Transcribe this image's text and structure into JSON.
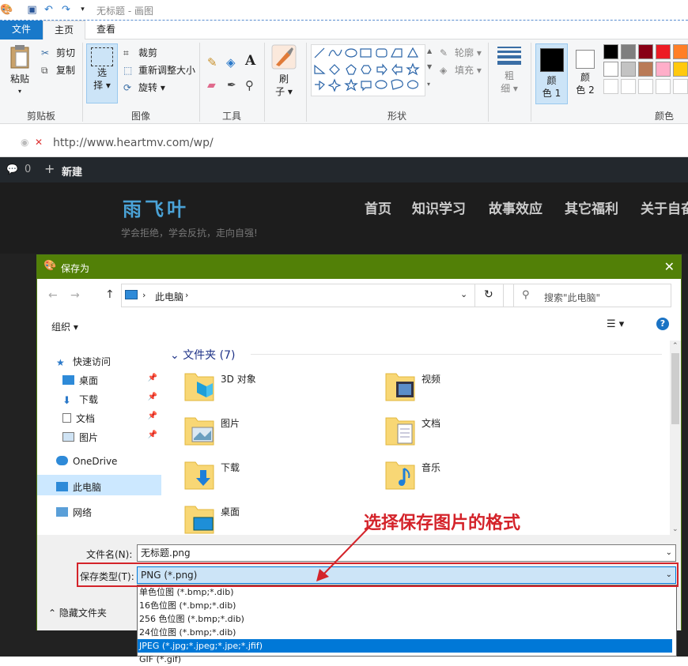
{
  "titlebar": {
    "title": "无标题 - 画图"
  },
  "tabs": {
    "file": "文件",
    "home": "主页",
    "view": "查看"
  },
  "ribbon": {
    "clipboard": {
      "paste": "粘贴",
      "cut": "剪切",
      "copy": "复制",
      "label": "剪贴板"
    },
    "image": {
      "select_top": "选",
      "select_bottom": "择",
      "crop": "裁剪",
      "resize": "重新调整大小",
      "rotate": "旋转",
      "label": "图像"
    },
    "tools": {
      "label": "工具"
    },
    "brush": {
      "top": "刷",
      "bottom": "子"
    },
    "shapes": {
      "outline": "轮廓",
      "fill": "填充",
      "label": "形状"
    },
    "size": {
      "top": "粗",
      "bottom": "细"
    },
    "color1": {
      "top": "颜",
      "bottom": "色 1"
    },
    "color2": {
      "top": "颜",
      "bottom": "色 2"
    },
    "colors": {
      "label": "颜色",
      "row1": [
        "#000000",
        "#7f7f7f",
        "#880015",
        "#ed1c24",
        "#ff7f27"
      ],
      "row2": [
        "#ffffff",
        "#c3c3c3",
        "#b97a57",
        "#ffaec9",
        "#ffc90e"
      ]
    }
  },
  "browser": {
    "url": "http://www.heartmv.com/wp/",
    "comments": "0",
    "new": "新建"
  },
  "site": {
    "logo": "雨飞叶",
    "tagline": "学会拒绝，学会反抗，走向自强!",
    "nav": [
      "首页",
      "知识学习",
      "故事效应",
      "其它福利",
      "关于自奋"
    ]
  },
  "dialog": {
    "title": "保存为",
    "address": "此电脑",
    "search_placeholder": "搜索\"此电脑\"",
    "organize": "组织",
    "nav": {
      "quick": "快速访问",
      "desktop": "桌面",
      "downloads": "下载",
      "documents": "文档",
      "pictures": "图片",
      "onedrive": "OneDrive",
      "thispc": "此电脑",
      "network": "网络"
    },
    "section": "文件夹 (7)",
    "folders": [
      "3D 对象",
      "视频",
      "图片",
      "文档",
      "下载",
      "音乐",
      "桌面"
    ],
    "filename_label": "文件名(N):",
    "filename": "无标题.png",
    "filetype_label": "保存类型(T):",
    "filetype": "PNG (*.png)",
    "hide_folders": "隐藏文件夹",
    "options": [
      "单色位图 (*.bmp;*.dib)",
      "16色位图 (*.bmp;*.dib)",
      "256 色位图 (*.bmp;*.dib)",
      "24位位图 (*.bmp;*.dib)",
      "JPEG (*.jpg;*.jpeg;*.jpe;*.jfif)",
      "GIF (*.gif)"
    ]
  },
  "annotation": "选择保存图片的格式"
}
